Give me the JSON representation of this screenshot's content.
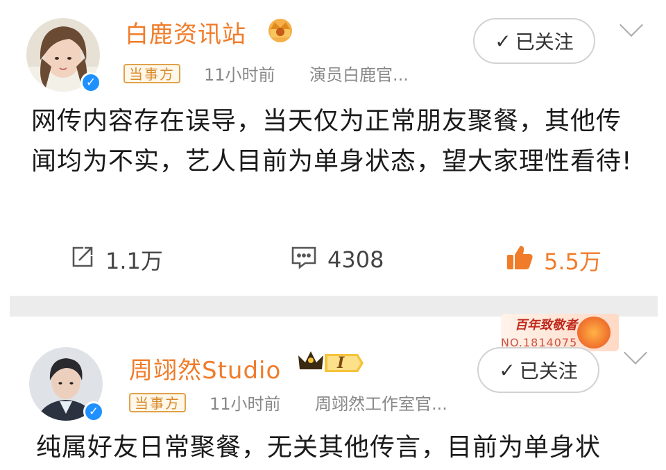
{
  "posts": [
    {
      "author": "白鹿资讯站",
      "tag": "当事方",
      "time": "11小时前",
      "source": "演员白鹿官...",
      "follow_label": "已关注",
      "content": "网传内容存在误导，当天仅为正常朋友聚餐，其他传闻均为不实，艺人目前为单身状态，望大家理性看待!",
      "repost_count": "1.1万",
      "comment_count": "4308",
      "like_count": "5.5万",
      "verified_mark": "✓",
      "follow_check": "✓"
    },
    {
      "author": "周翊然Studio",
      "tag": "当事方",
      "time": "11小时前",
      "source": "周翊然工作室官...",
      "follow_label": "已关注",
      "content": "纯属好友日常聚餐，无关其他传言，目前为单身状",
      "member_level": "I",
      "verified_mark": "✓",
      "follow_check": "✓",
      "promo_text": "百年致敬者",
      "promo_sub": "NO.1814075"
    }
  ],
  "colors": {
    "accent": "#f07c2a",
    "verified": "#1e90ff",
    "tag_border": "#e0a24a",
    "promo_red": "#c0281b"
  },
  "icons": {
    "repost": "repost-icon",
    "comment": "comment-icon",
    "like": "thumbs-up-icon",
    "chevron": "chevron-down-icon"
  }
}
